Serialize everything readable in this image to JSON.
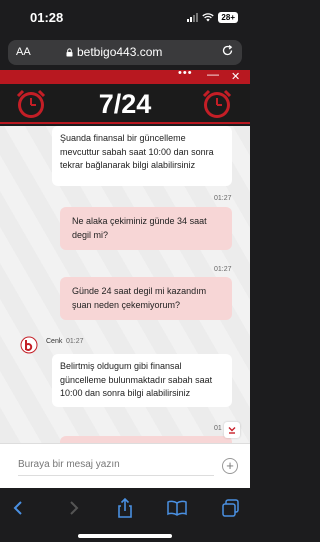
{
  "status_bar": {
    "time": "01:28",
    "battery": "28+"
  },
  "browser": {
    "aa_label": "AA",
    "url": "betbigo443.com"
  },
  "chat_header": {
    "dots": "•••",
    "title": "7/24"
  },
  "messages": [
    {
      "from": "agent",
      "text": "Şuanda finansal bir güncelleme mevcuttur sabah saat 10:00 dan sonra tekrar bağlanarak bilgi alabilirsiniz"
    },
    {
      "from": "user",
      "time": "01:27",
      "text": "Ne alaka çekiminiz günde 34 saat degil mi?"
    },
    {
      "from": "user",
      "time": "01:27",
      "text": "Günde 24 saat degil mi kazandım şuan neden çekemiyorum?"
    },
    {
      "from": "agent",
      "name": "Cenk",
      "time": "01:27",
      "text": "Belirtmiş oldugum gibi finansal güncelleme bulunmaktadır sabah saat 10:00 dan sonra bilgi alabilirsiniz"
    },
    {
      "from": "user",
      "time": "01",
      "text": ""
    }
  ],
  "input": {
    "placeholder": "Buraya bir mesaj yazın"
  },
  "colors": {
    "brand_red": "#b81820",
    "user_bubble": "#f7d6d6",
    "banner_bg": "#1b1b1b"
  },
  "icons": [
    "wifi-icon",
    "clock-icon",
    "reload-icon",
    "lock-icon",
    "add-icon",
    "back-icon",
    "forward-icon",
    "share-icon",
    "bookmarks-icon",
    "tabs-icon"
  ]
}
